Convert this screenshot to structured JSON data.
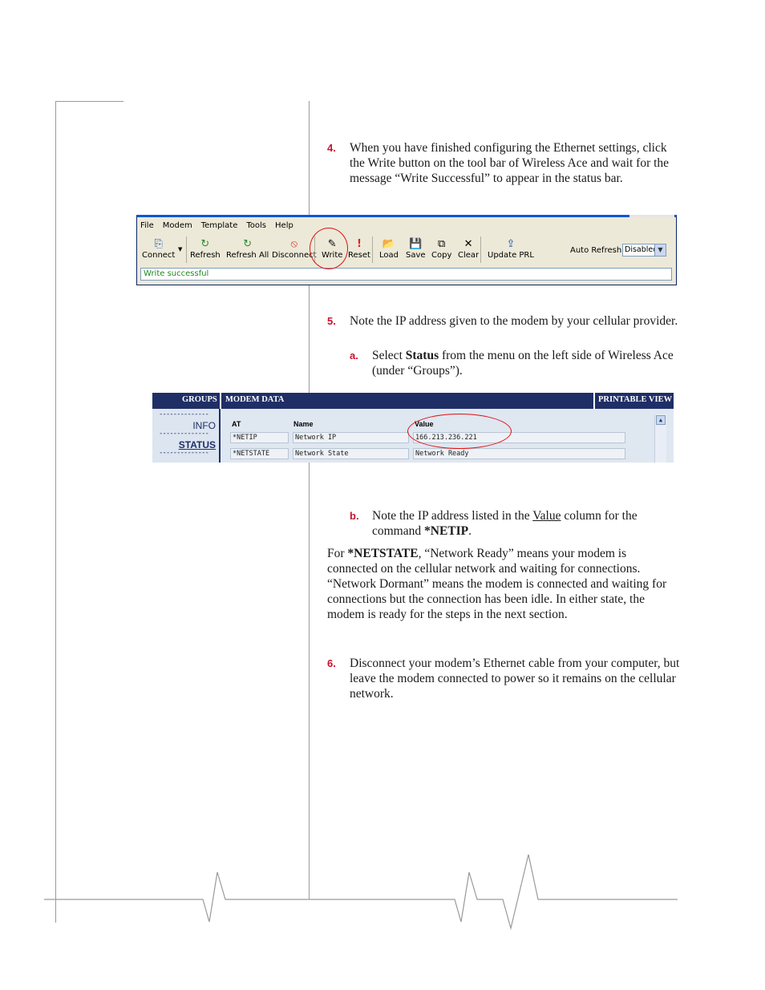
{
  "step4": {
    "number": "4.",
    "text": "When you have finished configuring the Ethernet settings, click the Write button on the tool bar of Wireless Ace and wait for the message “Write Successful” to appear in the status bar."
  },
  "toolbar_screenshot": {
    "menu": [
      "File",
      "Modem",
      "Template",
      "Tools",
      "Help"
    ],
    "buttons": {
      "connect": "Connect",
      "refresh": "Refresh",
      "refresh_all": "Refresh All",
      "disconnect": "Disconnect",
      "write": "Write",
      "reset": "Reset",
      "load": "Load",
      "save": "Save",
      "copy": "Copy",
      "clear": "Clear",
      "update_prl": "Update PRL"
    },
    "auto_refresh_label": "Auto Refresh:",
    "auto_refresh_value": "Disabled",
    "status_text": "Write successful",
    "highlight_color": "#d11111"
  },
  "step5": {
    "number": "5.",
    "text": "Note the IP address given to the modem by your cellular provider."
  },
  "step5a": {
    "number": "a.",
    "text_pre": "Select ",
    "text_bold": "Status",
    "text_post": " from the menu on the left side of Wireless Ace (under “Groups”)."
  },
  "groups_screenshot": {
    "groups_header": "GROUPS",
    "modem_data_header": "MODEM DATA",
    "printable_view": "PRINTABLE VIEW",
    "nav": {
      "divider": "--------------",
      "info": "INFO",
      "status": "STATUS"
    },
    "columns": {
      "at": "AT",
      "name": "Name",
      "value": "Value"
    },
    "rows": [
      {
        "at": "*NETIP",
        "name": "Network IP",
        "value": "166.213.236.221"
      },
      {
        "at": "*NETSTATE",
        "name": "Network State",
        "value": "Network Ready"
      }
    ],
    "header_color": "#1f2f66"
  },
  "step5b": {
    "number": "b.",
    "text_pre": "Note the IP address listed in the ",
    "text_underline": "Value",
    "text_mid": " column for the command ",
    "text_bold": "*NETIP",
    "text_post": "."
  },
  "netstate_para": {
    "pre": "For ",
    "bold": "*NETSTATE",
    "post": ", “Network Ready” means your modem is connected on the cellular network and waiting for connections. “Network Dormant” means the modem is connected and waiting for connections but the connection has been idle. In either state, the modem is ready for the steps in the next section."
  },
  "step6": {
    "number": "6.",
    "text": "Disconnect your modem’s Ethernet cable from your computer, but leave the modem connected to power so it remains on the cellular network."
  },
  "accent_color": "#c8102e"
}
